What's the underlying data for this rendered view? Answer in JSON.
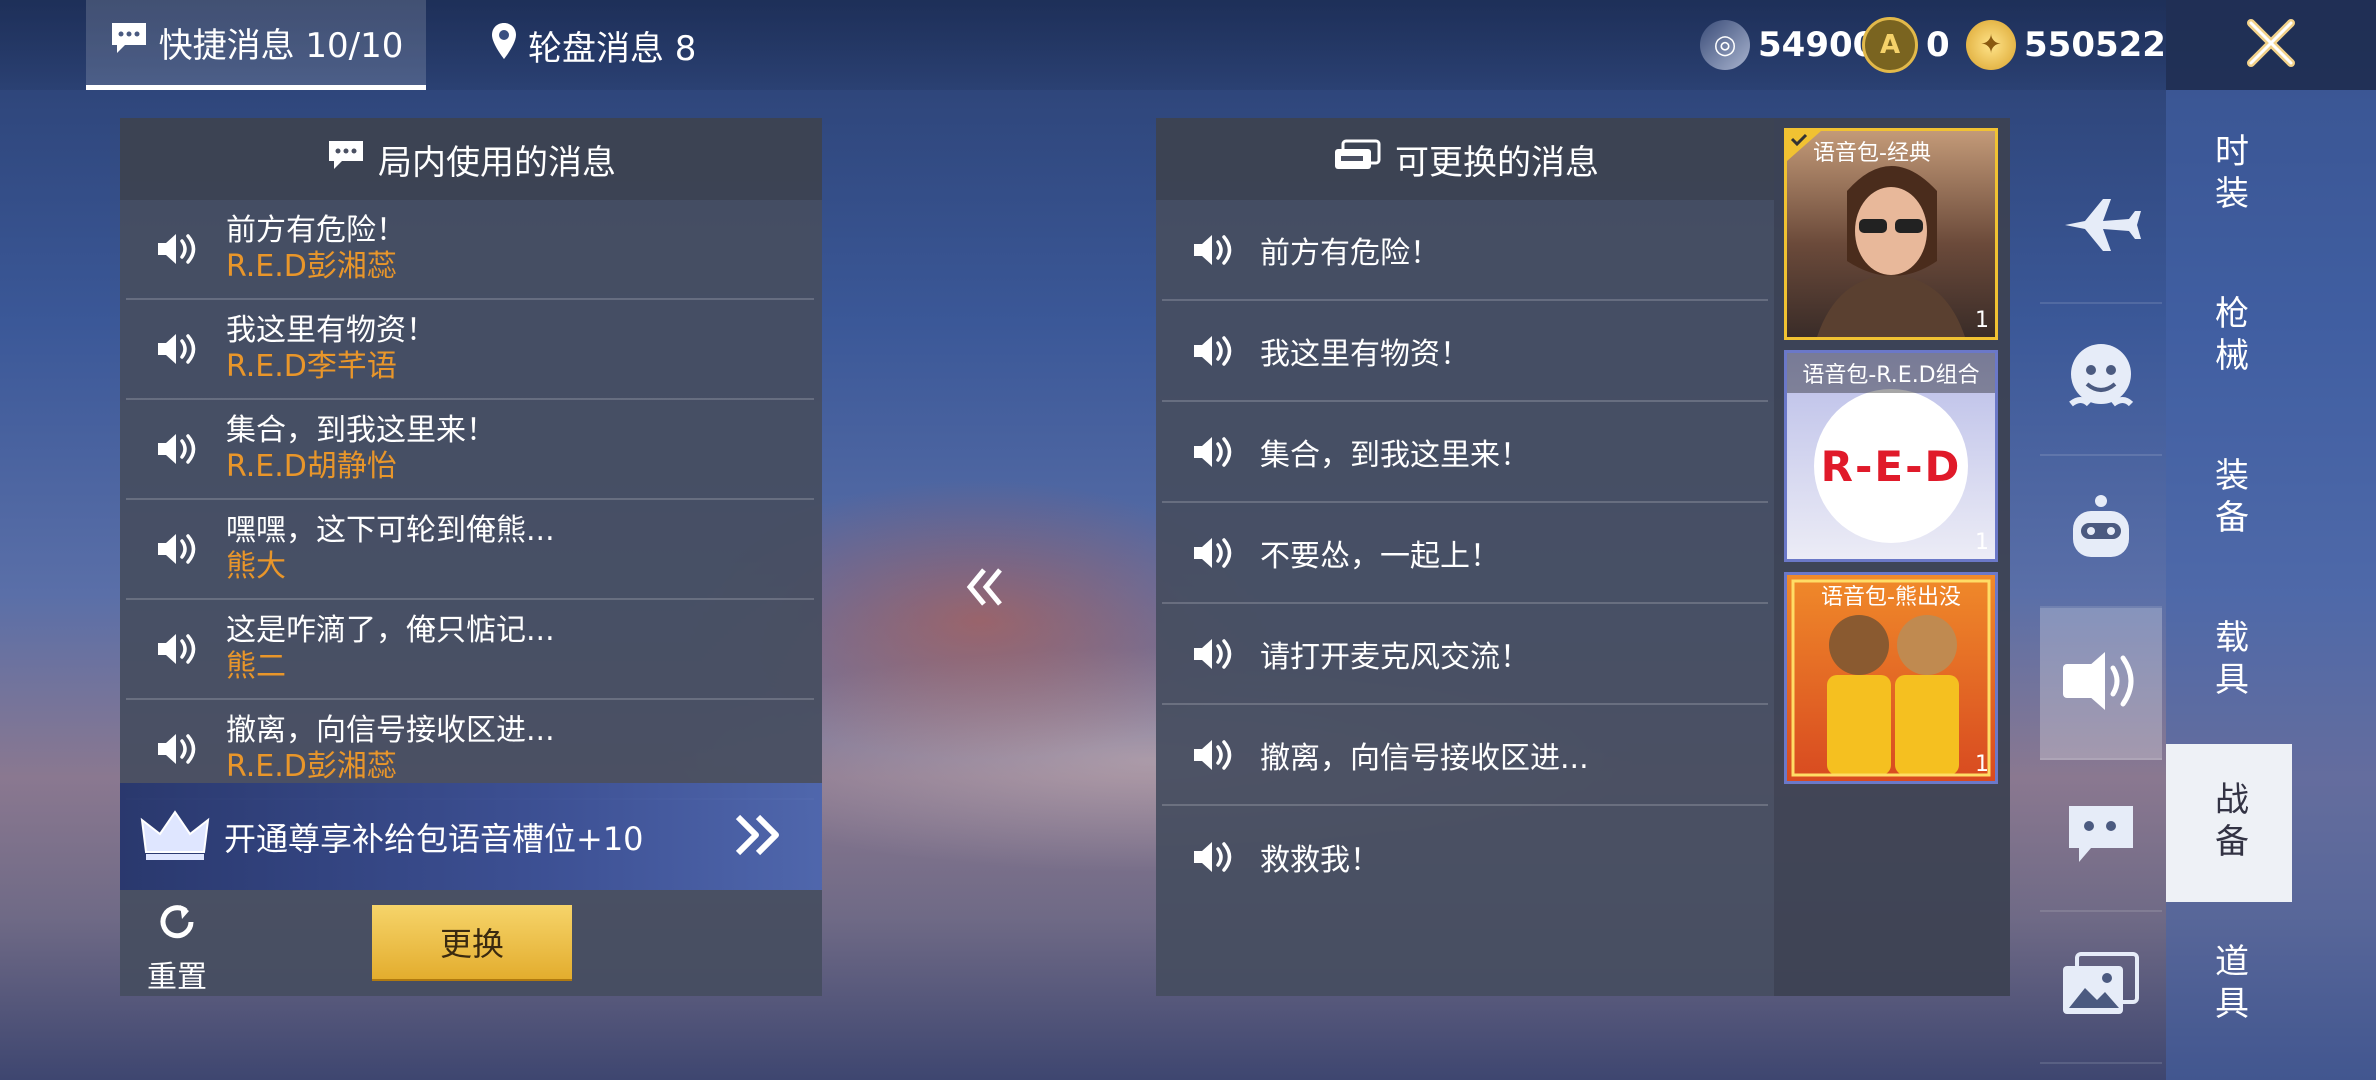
{
  "tabs": {
    "quick_messages": "快捷消息 10/10",
    "wheel_messages": "轮盘消息 8"
  },
  "currency": {
    "silver": "54900",
    "ag": "0",
    "gold": "550522"
  },
  "left_panel": {
    "title": "局内使用的消息",
    "items": [
      {
        "message": "前方有危险！",
        "source": "R.E.D彭湘蕊"
      },
      {
        "message": "我这里有物资！",
        "source": "R.E.D李芊语"
      },
      {
        "message": "集合，到我这里来！",
        "source": "R.E.D胡静怡"
      },
      {
        "message": "嘿嘿，这下可轮到俺熊...",
        "source": "熊大"
      },
      {
        "message": "这是咋滴了，俺只惦记...",
        "source": "熊二"
      },
      {
        "message": "撤离，向信号接收区进...",
        "source": "R.E.D彭湘蕊"
      }
    ],
    "promo": "开通尊享补给包语音槽位+10",
    "reset_label": "重置",
    "swap_label": "更换"
  },
  "right_panel": {
    "title": "可更换的消息",
    "items": [
      "前方有危险！",
      "我这里有物资！",
      "集合，到我这里来！",
      "不要怂，一起上！",
      "请打开麦克风交流！",
      "撤离，向信号接收区进...",
      "救救我！"
    ]
  },
  "voice_packs": [
    {
      "label": "语音包-经典",
      "count": "1",
      "selected": true
    },
    {
      "label": "语音包-R.E.D组合",
      "count": "1",
      "logo": "R-E-D"
    },
    {
      "label": "语音包-熊出没",
      "count": "1"
    }
  ],
  "side_icons": [
    "plane-icon",
    "emote-face-icon",
    "robot-icon",
    "speaker-icon",
    "chat-bubble-icon",
    "gallery-icon"
  ],
  "categories": [
    "时装",
    "枪械",
    "装备",
    "载具",
    "战备",
    "道具"
  ],
  "active_category": "战备",
  "colors": {
    "accent_orange": "#e9962a",
    "button_gold": "#f0c44c"
  }
}
